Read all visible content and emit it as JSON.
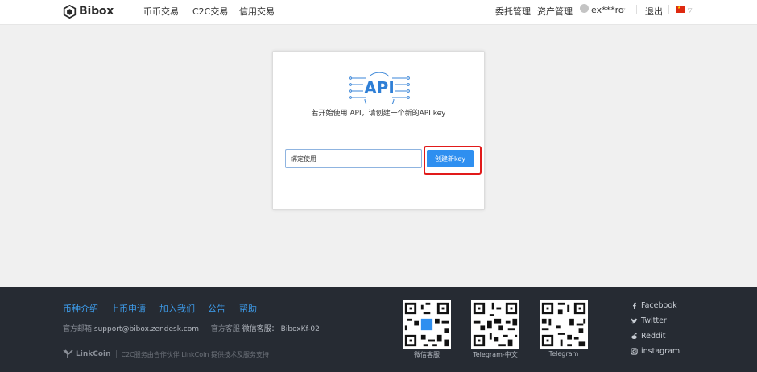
{
  "header": {
    "brand": "Bibox",
    "nav": [
      "币币交易",
      "C2C交易",
      "信用交易"
    ],
    "right_nav": [
      "委托管理",
      "资产管理"
    ],
    "user": "ex***ro",
    "logout": "退出"
  },
  "api_card": {
    "intro": "若开始使用 API，请创建一个新的API key",
    "input_value": "绑定使用",
    "create_button": "创建新key",
    "illustration_text": "API"
  },
  "footer": {
    "links": [
      "币种介绍",
      "上币申请",
      "加入我们",
      "公告",
      "帮助"
    ],
    "email_label": "官方邮箱",
    "email": "support@bibox.zendesk.com",
    "service_label": "官方客服",
    "wechat_label": "微信客服：",
    "wechat_id": "BiboxKf-02",
    "partner_brand": "LinkCoin",
    "partner_text": "C2C服务由合作伙伴 LinkCoin 提供技术及服务支持",
    "qr_codes": [
      {
        "label": "微信客服"
      },
      {
        "label": "Telegram-中文"
      },
      {
        "label": "Telegram"
      }
    ],
    "social": [
      {
        "icon": "facebook-icon",
        "label": "Facebook"
      },
      {
        "icon": "twitter-icon",
        "label": "Twitter"
      },
      {
        "icon": "reddit-icon",
        "label": "Reddit"
      },
      {
        "icon": "instagram-icon",
        "label": "instagram"
      }
    ]
  },
  "colors": {
    "accent_blue": "#2e8ff0",
    "footer_bg": "#262b33",
    "footer_link": "#3d9be9",
    "highlight_red": "#e11a1a"
  }
}
